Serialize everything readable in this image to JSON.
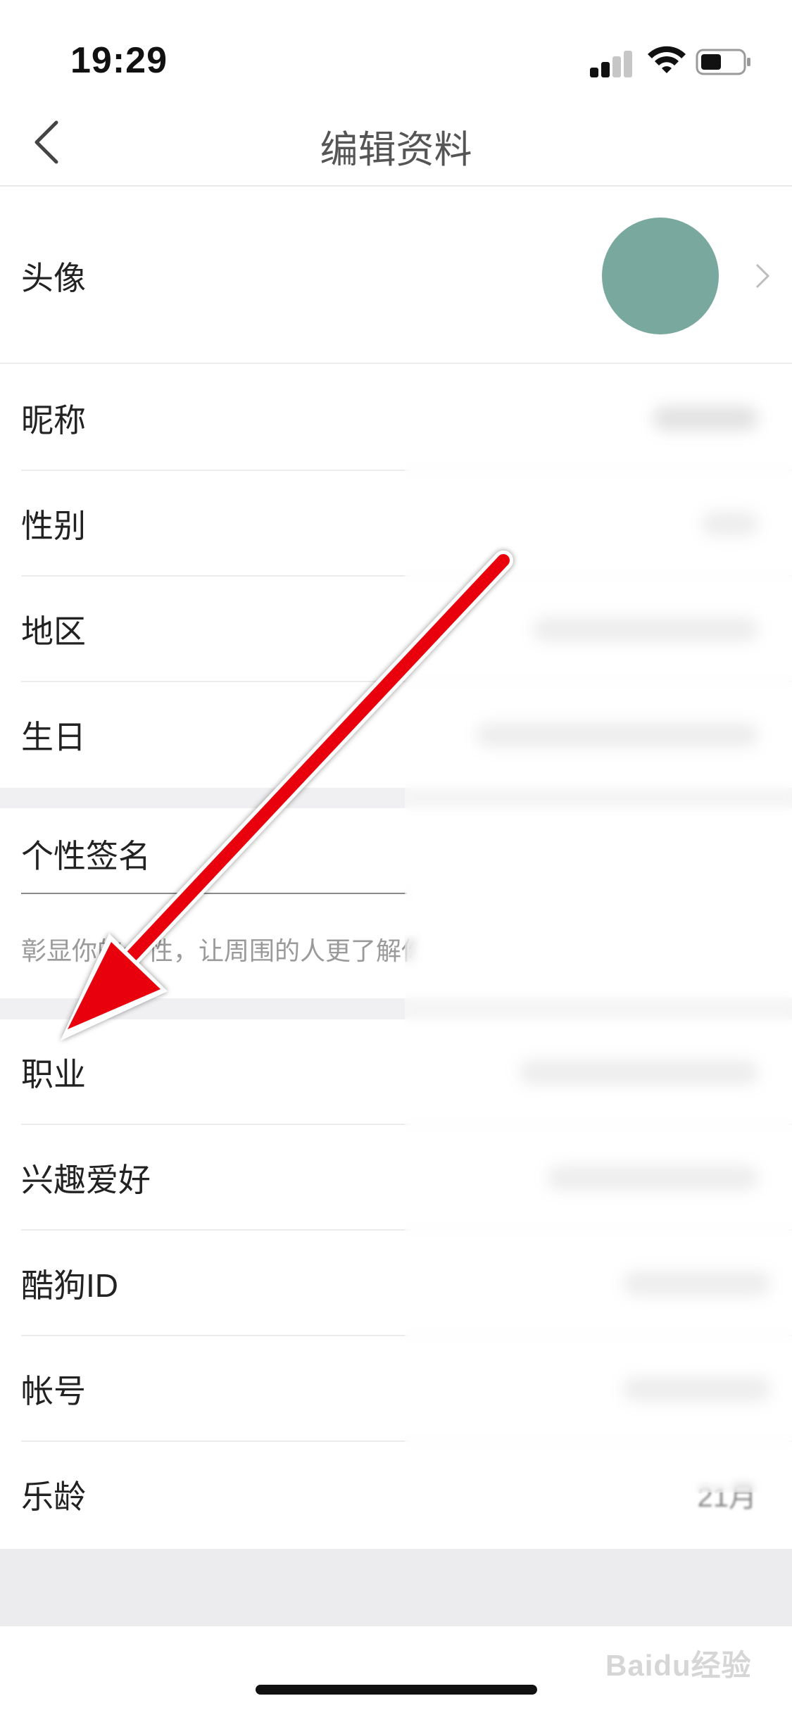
{
  "status_bar": {
    "time": "19:29"
  },
  "nav": {
    "title": "编辑资料"
  },
  "rows": {
    "avatar": "头像",
    "nickname": "昵称",
    "gender": "性别",
    "region": "地区",
    "birthday": "生日",
    "signature": "个性签名",
    "signature_placeholder": "彰显你的个性，让周围的人更了解你",
    "occupation": "职业",
    "hobbies": "兴趣爱好",
    "kugou_id": "酷狗ID",
    "account": "帐号",
    "music_age": "乐龄",
    "music_age_value": "21月"
  },
  "watermark": "Baidu经验",
  "colors": {
    "avatar": "#79a89e",
    "arrow": "#e8000b",
    "section_gap": "#f0f0f2"
  }
}
